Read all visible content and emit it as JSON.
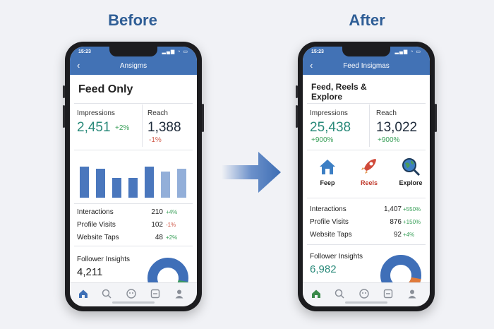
{
  "headings": {
    "before": "Before",
    "after": "After"
  },
  "before": {
    "status_time": "15:23",
    "appbar_title": "Ansigms",
    "page_title": "Feed Only",
    "impressions": {
      "label": "Impressions",
      "value": "2,451",
      "change": "+2%"
    },
    "reach": {
      "label": "Reach",
      "value": "1,388",
      "change": "-1%"
    },
    "bar_levels": [
      0.78,
      0.74,
      0.5,
      0.5,
      0.78,
      0.66,
      0.74
    ],
    "rows": [
      {
        "label": "Interactions",
        "value": "210",
        "change": "+4%",
        "trend": "up"
      },
      {
        "label": "Profile Visits",
        "value": "102",
        "change": "-1%",
        "trend": "down"
      },
      {
        "label": "Website Taps",
        "value": "48",
        "change": "+2%",
        "trend": "up"
      }
    ],
    "follower_insights": {
      "label": "Follower Insights",
      "value": "4,211"
    }
  },
  "after": {
    "status_time": "15:23",
    "appbar_title": "Feed Insigmas",
    "page_title_line1": "Feed, Reels &",
    "page_title_line2": "Explore",
    "impressions": {
      "label": "Impressions",
      "value": "25,438",
      "change": "+900%"
    },
    "reach": {
      "label": "Reach",
      "value": "13,022",
      "change": "+900%"
    },
    "tiles": [
      {
        "label": "Feep",
        "icon": "home-icon"
      },
      {
        "label": "Reels",
        "icon": "rocket-icon"
      },
      {
        "label": "Explore",
        "icon": "globe-search-icon"
      }
    ],
    "rows": [
      {
        "label": "Interactions",
        "value": "1,407",
        "change": "+550%",
        "trend": "up"
      },
      {
        "label": "Profile Visits",
        "value": "876",
        "change": "+150%",
        "trend": "up"
      },
      {
        "label": "Website Taps",
        "value": "92",
        "change": "+4%",
        "trend": "up"
      }
    ],
    "follower_insights": {
      "label": "Follower Insights",
      "value": "6,982"
    }
  },
  "colors": {
    "accent": "#4272b5",
    "heading": "#2f5e96",
    "positive": "#3aa05a",
    "negative": "#d05a4a",
    "teal": "#2a8a7a"
  }
}
